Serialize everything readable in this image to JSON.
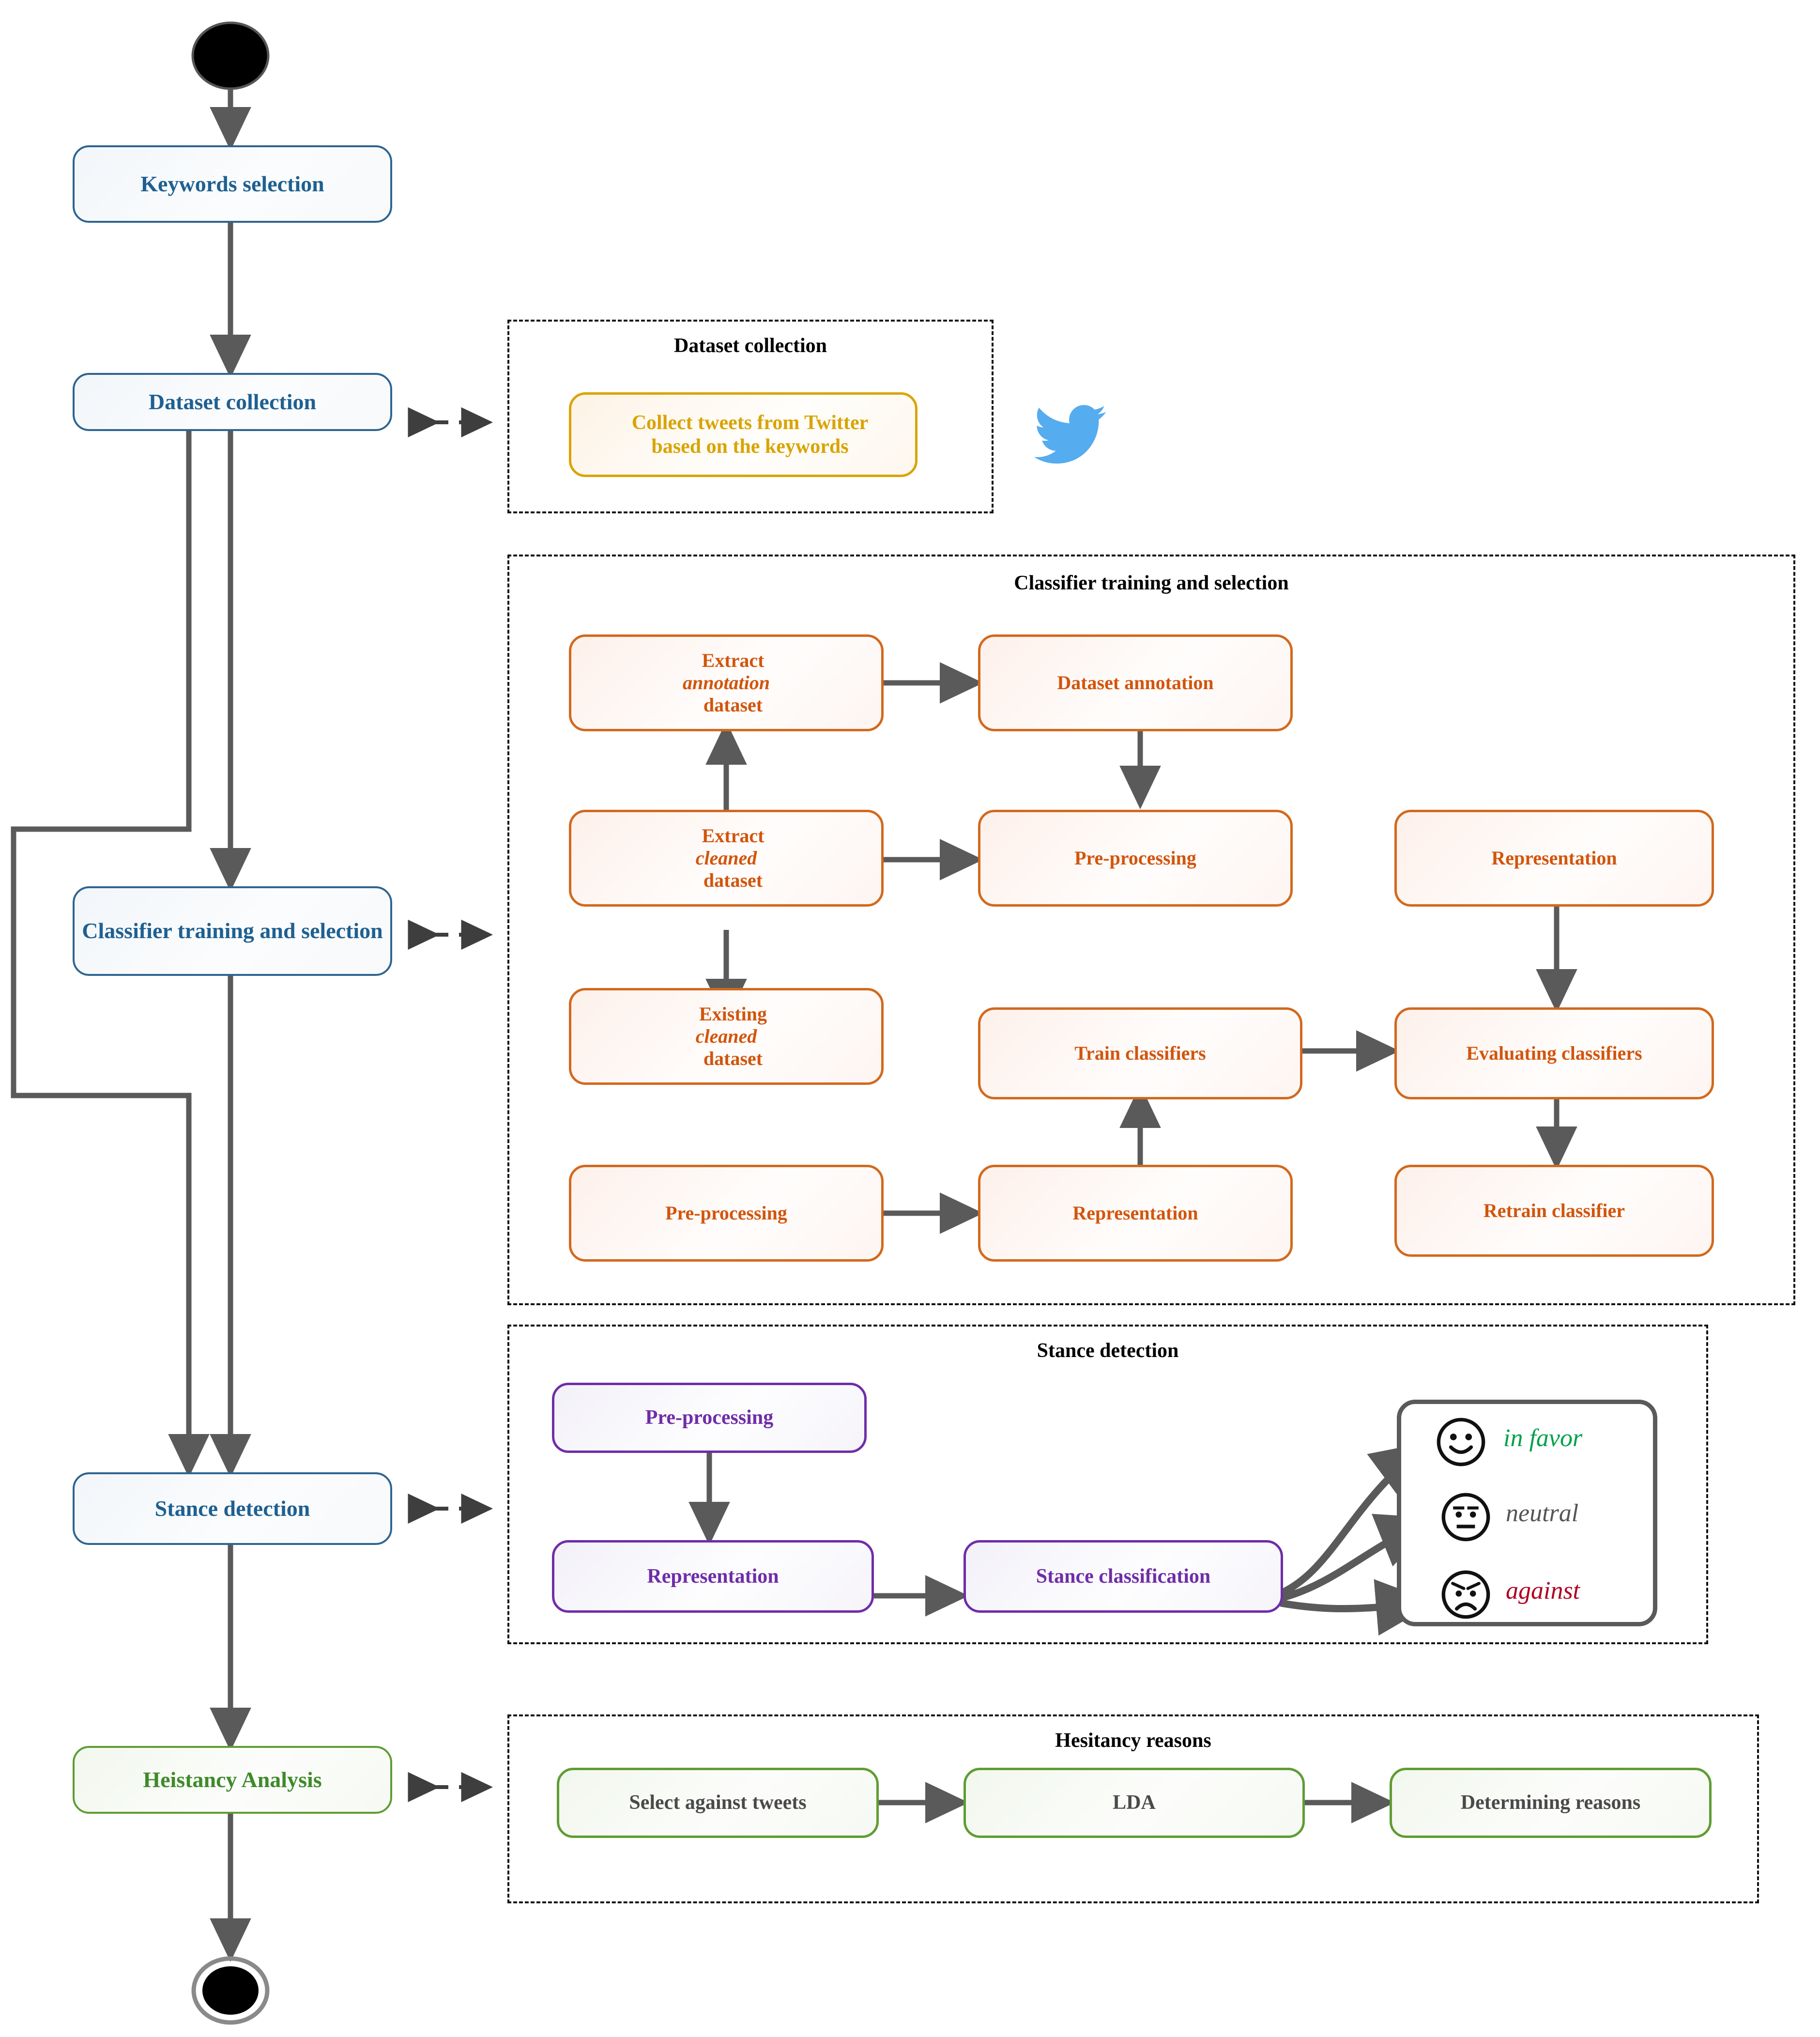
{
  "flow": {
    "start_node": "initial-state",
    "end_node": "final-state",
    "main_steps": [
      {
        "id": "keywords-selection",
        "label": "Keywords selection",
        "color": "#1f6091"
      },
      {
        "id": "dataset-collection",
        "label": "Dataset collection",
        "color": "#1f6091"
      },
      {
        "id": "classifier-training-and-selection",
        "label": "Classifier training and selection",
        "color": "#1f6091"
      },
      {
        "id": "stance-detection",
        "label": "Stance detection",
        "color": "#1f6091"
      },
      {
        "id": "heistancy-analysis",
        "label": "Heistancy Analysis",
        "color": "#3f8a2a"
      }
    ]
  },
  "panels": {
    "dataset_collection": {
      "title": "Dataset collection",
      "nodes": [
        {
          "id": "collect-tweets",
          "line1": "Collect tweets from Twitter",
          "line2": "based on the keywords"
        }
      ],
      "icon": "twitter-bird-icon",
      "accent": "#d9a400"
    },
    "classifier_training": {
      "title": "Classifier training and selection",
      "accent": "#d2550c",
      "nodes": [
        {
          "id": "extract-annotation-dataset",
          "pre": "Extract ",
          "em": "annotation",
          "post": "",
          "line2": "dataset"
        },
        {
          "id": "dataset-annotation",
          "label": "Dataset annotation"
        },
        {
          "id": "extract-cleaned-dataset",
          "pre": "Extract ",
          "em": "cleaned",
          "post": " dataset"
        },
        {
          "id": "pre-processing-top",
          "label": "Pre-processing"
        },
        {
          "id": "representation-top",
          "label": "Representation"
        },
        {
          "id": "existing-cleaned-dataset",
          "pre": "Existing ",
          "em": "cleaned",
          "post": " dataset"
        },
        {
          "id": "train-classifiers",
          "label": "Train classifiers"
        },
        {
          "id": "evaluating-classifiers",
          "label": "Evaluating classifiers"
        },
        {
          "id": "pre-processing-bottom",
          "label": "Pre-processing"
        },
        {
          "id": "representation-bottom",
          "label": "Representation"
        },
        {
          "id": "retrain-classifier",
          "label": "Retrain classifier"
        }
      ]
    },
    "stance_detection": {
      "title": "Stance detection",
      "accent": "#6f2da8",
      "nodes": [
        {
          "id": "stance-pre-processing",
          "label": "Pre-processing"
        },
        {
          "id": "stance-representation",
          "label": "Representation"
        },
        {
          "id": "stance-classification",
          "label": "Stance classification"
        }
      ],
      "outcomes": [
        {
          "id": "outcome-in-favor",
          "label": "in favor",
          "color": "#00a14b",
          "face": "smiley-face-icon"
        },
        {
          "id": "outcome-neutral",
          "label": "neutral",
          "color": "#555555",
          "face": "neutral-face-icon"
        },
        {
          "id": "outcome-against",
          "label": "against",
          "color": "#b00020",
          "face": "frowning-face-icon"
        }
      ]
    },
    "hesitancy_reasons": {
      "title": "Hesitancy reasons",
      "accent": "#5f9c32",
      "nodes": [
        {
          "id": "select-against-tweets",
          "label": "Select against tweets"
        },
        {
          "id": "lda",
          "label": "LDA"
        },
        {
          "id": "determining-reasons",
          "label": "Determining reasons"
        }
      ]
    }
  },
  "colors": {
    "blue": "#1f6091",
    "blue_border": "#2e6491",
    "green": "#3f8a2a",
    "green_border": "#5f9c32",
    "orange": "#d2550c",
    "orange_border": "#d2691e",
    "yellow": "#d9a400",
    "purple": "#6f2da8",
    "arrow": "#5a5a5a",
    "twitter": "#55acee"
  }
}
